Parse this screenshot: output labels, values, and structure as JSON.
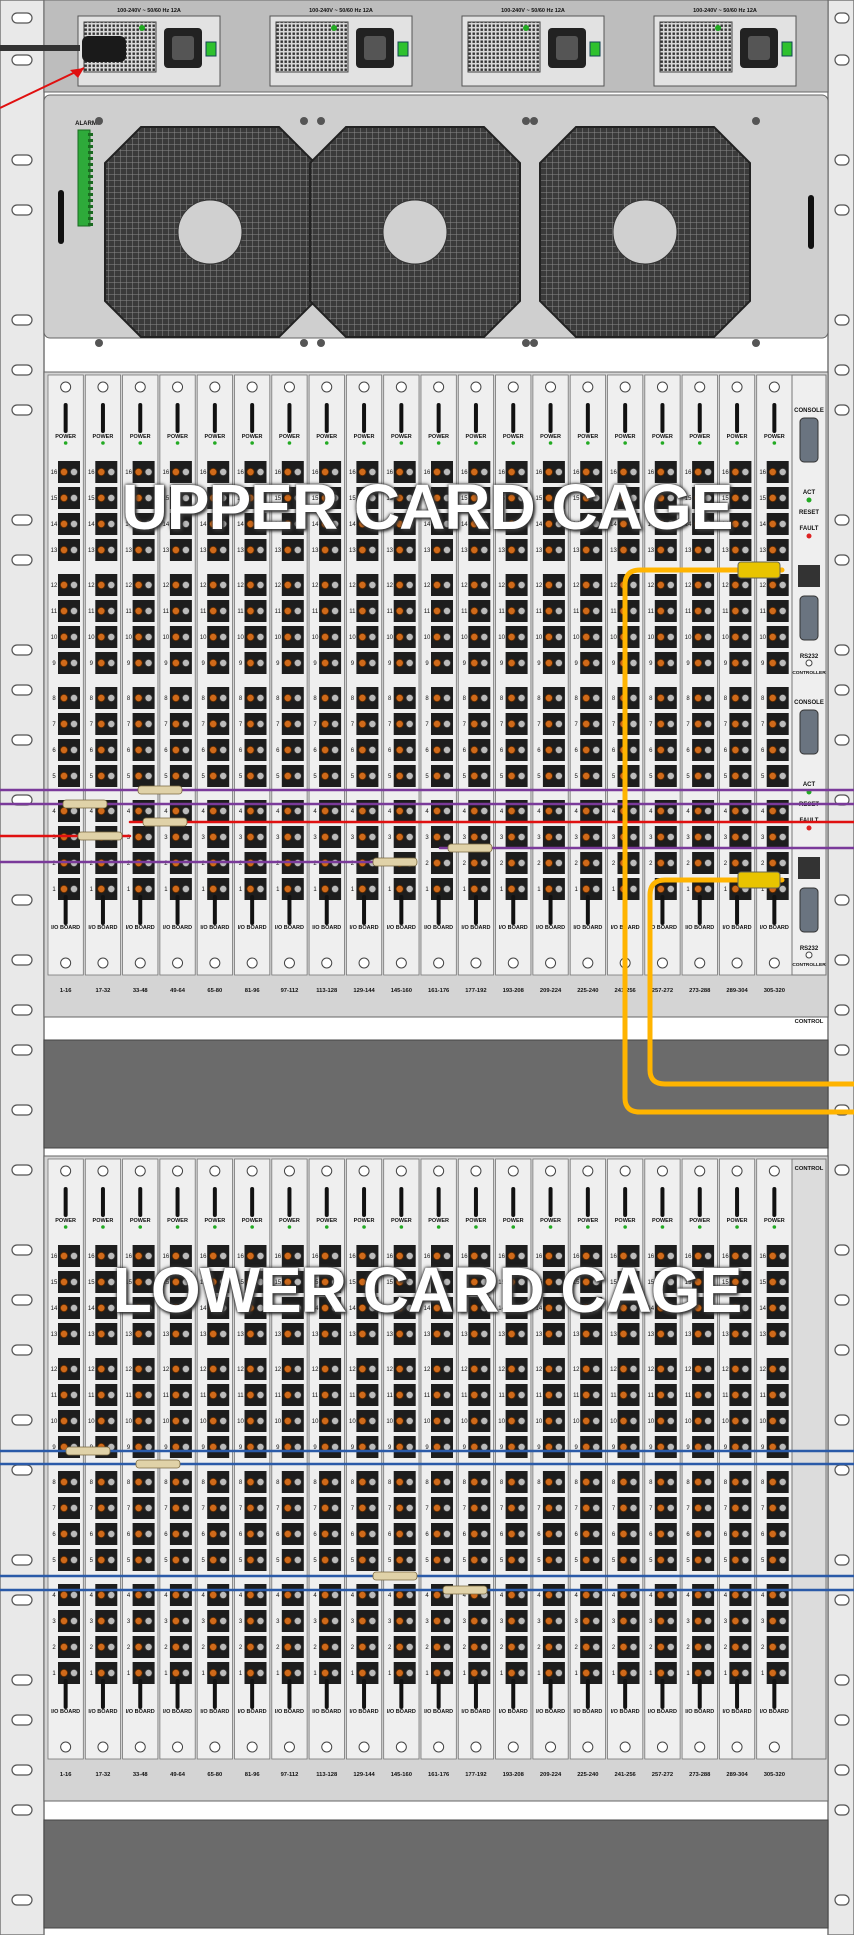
{
  "psu": {
    "rating_label": "100-240V ~ 50/60 Hz 12A",
    "count": 4
  },
  "fan_tray": {
    "alarm_label": "ALARM",
    "fan_count": 3
  },
  "upper_cage": {
    "title": "UPPER CARD CAGE",
    "power_label": "POWER",
    "io_label": "I/O BOARD",
    "slot_labels": [
      "1-16",
      "17-32",
      "33-48",
      "49-64",
      "65-80",
      "81-96",
      "97-112",
      "113-128",
      "129-144",
      "145-160",
      "161-176",
      "177-192",
      "193-208",
      "209-224",
      "225-240",
      "241-256",
      "257-272",
      "273-288",
      "289-304",
      "305-320"
    ],
    "control_label": "CONTROL",
    "controllers": [
      {
        "console": "CONSOLE",
        "act": "ACT",
        "reset": "RESET",
        "fault": "FAULT",
        "rs232": "RS232",
        "name": "CONTROLLER"
      },
      {
        "console": "CONSOLE",
        "act": "ACT",
        "reset": "RESET",
        "fault": "FAULT",
        "rs232": "RS232",
        "name": "CONTROLLER"
      }
    ]
  },
  "lower_cage": {
    "title": "LOWER CARD CAGE",
    "power_label": "POWER",
    "io_label": "I/O BOARD",
    "slot_labels": [
      "1-16",
      "17-32",
      "33-48",
      "49-64",
      "65-80",
      "81-96",
      "97-112",
      "113-128",
      "129-144",
      "145-160",
      "161-176",
      "177-192",
      "193-208",
      "209-224",
      "225-240",
      "241-256",
      "257-272",
      "273-288",
      "289-304",
      "305-320"
    ],
    "control_label": "CONTROL"
  },
  "port_numbers": [
    "16",
    "15",
    "14",
    "13",
    "12",
    "11",
    "10",
    "9",
    "8",
    "7",
    "6",
    "5",
    "4",
    "3",
    "2",
    "1"
  ],
  "colors": {
    "rack_rail": "#e6e6e6",
    "chassis": "#d0d0d0",
    "card": "#efefef",
    "blank_panel": "#6b6b6b",
    "cable_red": "#e01010",
    "cable_purple": "#7a3a9a",
    "cable_blue": "#2a5aa8",
    "cable_yellow": "#ffb400",
    "connector_tan": "#e0d2a8",
    "port_orange": "#d06a1a",
    "led_green": "#22aa22",
    "led_red": "#dd2222"
  }
}
